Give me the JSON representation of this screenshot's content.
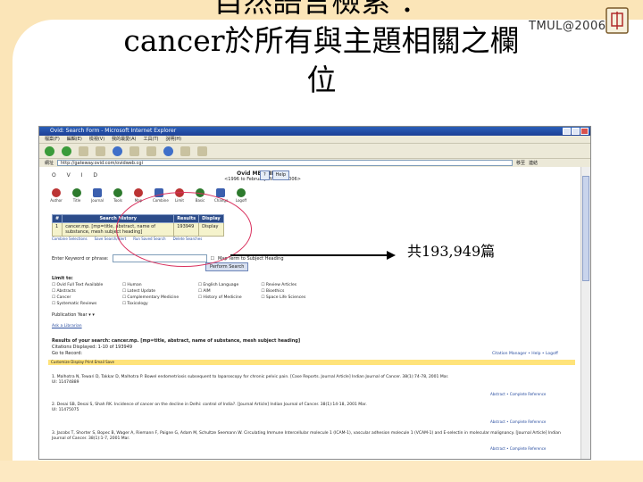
{
  "slide": {
    "title_lines": [
      "自然語言檢索 ：",
      "cancer於所有與主題相關之欄",
      "位"
    ],
    "logo_text": "TMUL@2006",
    "result_count_label": "共193,949篇"
  },
  "colors": {
    "accent_band": "#fbe5b8",
    "circle": "#d9315e",
    "window_title": "#2b5fb8"
  },
  "browser": {
    "window_title": "Ovid: Search Form - Microsoft Internet Explorer",
    "menu": [
      "檔案(F)",
      "編輯(E)",
      "檢視(V)",
      "我的最愛(A)",
      "工具(T)",
      "說明(H)"
    ],
    "address_label": "網址",
    "address_value": "http://gateway.ovid.com/ovidweb.cgi",
    "go_label": "移至",
    "links_label": "連結"
  },
  "ovid": {
    "logo": "O V I D",
    "db_title": "Ovid MEDLINE(R)",
    "db_sub": "<1996 to February Week 2 2006>",
    "help_labels": [
      "?",
      "Help"
    ],
    "icons": [
      "Author",
      "Title",
      "Journal",
      "Tools",
      "Map",
      "Combine",
      "Limit",
      "Basic",
      "Change",
      "Logoff"
    ],
    "history_headers": [
      "#",
      "Search History",
      "Results",
      "Display"
    ],
    "history_row": {
      "num": "1",
      "query": "cancer.mp. [mp=title, abstract, name of substance, mesh subject heading]",
      "results": "193949",
      "display": "Display"
    },
    "history_buttons": [
      "Combine Selections",
      "Save Search/Alert",
      "Run Saved Search",
      "Delete Searches"
    ],
    "search_label": "Enter Keyword or phrase:",
    "map_label": "Map Term to Subject Heading",
    "perform_button": "Perform Search",
    "limit_title": "Limit to:",
    "limits": [
      "Ovid Full Text Available",
      "Human",
      "English Language",
      "Review Articles",
      "Abstracts",
      "Latest Update",
      "AIM",
      "Bioethics",
      "Cancer",
      "Complementary Medicine",
      "History of Medicine",
      "Space Life Sciences",
      "Systematic Reviews",
      "Toxicology",
      "",
      ""
    ],
    "pub_year_label": "Publication Year",
    "ask_link": "Ask a Librarian",
    "results_header": "Results of your search: cancer.mp. [mp=title, abstract, name of substance, mesh subject heading]",
    "citations_line": "Citations Displayed: 1-10 of 193949",
    "go_record_label": "Go to Record:",
    "citation_manager": "Citation Manager  •  Help  •  Logoff",
    "customize_bar": "Customize Display  Print  Email  Save",
    "results": [
      {
        "text": "1. Malhotra N, Tewari D, Takkar D, Malhotra P. Bowel endometriosis subsequent to laparoscopy for chronic pelvic pain. [Case Reports. Journal Article] Indian Journal of Cancer. 38(1):74-78, 2001 Mar.",
        "ui": "UI: 11474889",
        "links": "Abstract  •  Complete Reference"
      },
      {
        "text": "2. Desai SB, Desai S, Shah RK. Incidence of cancer on the decline in Delhi: control of India?. [Journal Article] Indian Journal of Cancer. 38(1):14-18, 2001 Mar.",
        "ui": "UI: 11475075",
        "links": "Abstract  •  Complete Reference"
      },
      {
        "text": "3. Jacobs T, Shorter S, Bopec B, Wager A, Riemann F, Paigne G, Adam M, Schultze Seemann W. Circulating Immune Intercellular molecule 1 (ICAM-1), vascular adhesion molecule 1 (VCAM-1) and E-selectin in molecular malignancy. [Journal Article] Indian Journal of Cancer. 38(1):1-7, 2001 Mar.",
        "ui": "",
        "links": "Abstract  •  Complete Reference"
      }
    ]
  }
}
